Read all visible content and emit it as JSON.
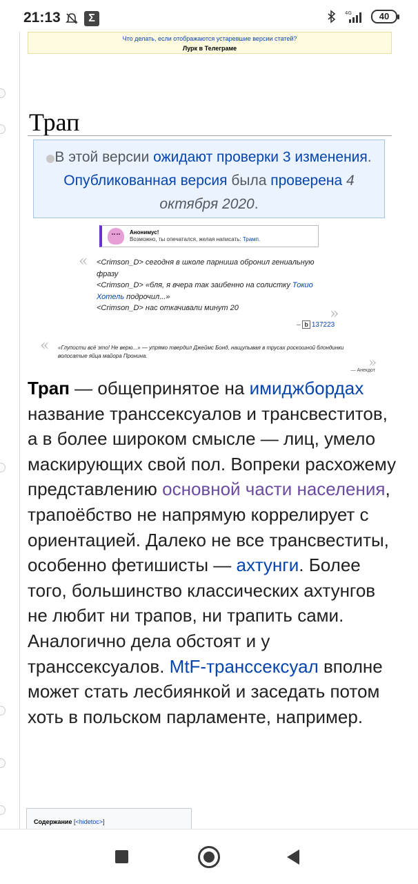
{
  "status_bar": {
    "time": "21:13",
    "network": "4G",
    "battery": "40",
    "icons": [
      "mute-bell-icon",
      "sigma-app-icon",
      "bluetooth-icon",
      "signal-icon",
      "battery-icon"
    ]
  },
  "notice": {
    "line1": "Что делать, если отображаются устаревшие версии статей?",
    "line2": "Лурк в Телеграме"
  },
  "article": {
    "title": "Трап"
  },
  "review": {
    "text1": "В этой версии ",
    "link1": "ожидают проверки",
    "link2": " 3 изменения",
    "text2": ". ",
    "link3": "Опубликованная версия",
    "text3": " была ",
    "link4": "проверена",
    "date": " 4 октября 2020",
    "text4": "."
  },
  "anon": {
    "title": "Анонимус!",
    "text": "Возможно, ты опечатался, желая написать: ",
    "link": "Трамп."
  },
  "quote1": {
    "l1": "<Crimson_D> сегодня в школе парниша обронил гениальную фразу",
    "l2a": "<Crimson_D> «бля, я вчера так заибенно на солистку ",
    "l2link": "Токио Хотель",
    "l2b": " подрочил...»",
    "l3": "<Crimson_D> нас откачивали минут 20",
    "source_badge": "b",
    "source_num": "137223"
  },
  "quote2": {
    "text": "«Глупости всё это! Не верю...» — упрямо твердил Джеймс Бонд, нащупывая в трусах роскошной блондинки волосатые яйца майора Пронина.",
    "source": "— Анекдот"
  },
  "intro": {
    "term": "Трап",
    "t1": " — общепринятое на ",
    "link1": "имиджбордах",
    "t2": " название транссексуалов и трансвеститов, а в более широком смысле — лиц, умело маскирующих свой пол. Вопреки расхожему представлению ",
    "link2": "основной части населения",
    "t3": ", трапоёбство не напрямую коррелирует с ориентацией. Далеко не все трансвеститы, особенно фетишисты — ",
    "link3": "ахтунги",
    "t4": ". Более того, большинство классических ахтунгов не любит ни трапов, ни трапить сами. Аналогично дела обстоят и у транссексуалов. ",
    "link4": "MtF-транссексуал",
    "t5": " вполне может стать лесбиянкой и заседать потом хоть в польском парламенте, например."
  },
  "toc": {
    "title": "Содержание",
    "toggle": "<hidetoc>"
  },
  "nav": {
    "icons": [
      "recents-square-icon",
      "home-circle-icon",
      "back-triangle-icon"
    ]
  }
}
